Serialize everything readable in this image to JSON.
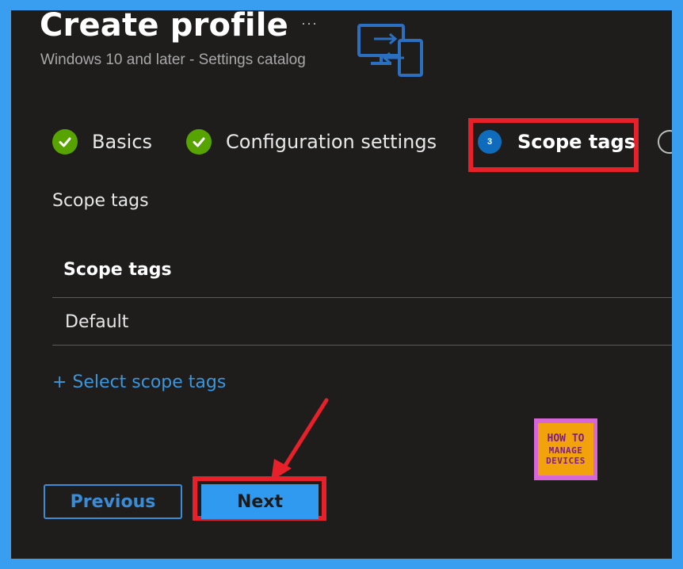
{
  "header": {
    "title": "Create profile",
    "more_label": "···",
    "subtitle": "Windows 10 and later - Settings catalog"
  },
  "steps": [
    {
      "label": "Basics",
      "status": "complete"
    },
    {
      "label": "Configuration settings",
      "status": "complete"
    },
    {
      "number": "3",
      "label": "Scope tags",
      "status": "current"
    }
  ],
  "scope": {
    "section_label": "Scope tags",
    "column_header": "Scope tags",
    "rows": [
      "Default"
    ],
    "select_link": "+ Select scope tags"
  },
  "footer": {
    "previous_label": "Previous",
    "next_label": "Next"
  },
  "watermark": {
    "line1": "HOW TO",
    "line2": "MANAGE",
    "line3": "DEVICES"
  },
  "colors": {
    "background": "#1e1d1c",
    "frame": "#3a9ef0",
    "accent": "#3a96dd",
    "check": "#57a300",
    "highlight": "#e8202a"
  },
  "icons": {
    "brand": "device-sync-icon",
    "check": "checkmark-circle-icon",
    "arrow": "annotation-arrow"
  }
}
